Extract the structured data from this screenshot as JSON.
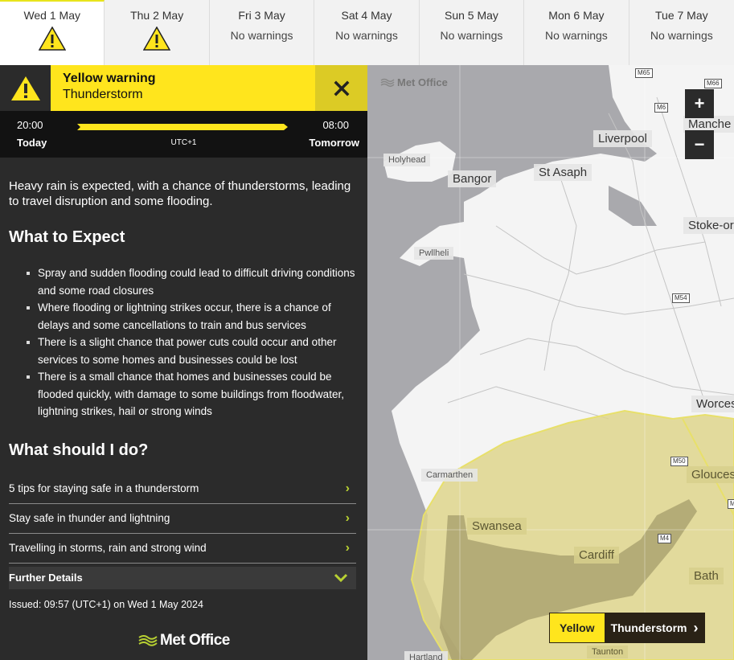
{
  "tabs": [
    {
      "day": "Wed 1 May",
      "status": "warning-icon",
      "active": true
    },
    {
      "day": "Thu 2 May",
      "status": "warning-icon",
      "active": false
    },
    {
      "day": "Fri 3 May",
      "sub": "No warnings"
    },
    {
      "day": "Sat 4 May",
      "sub": "No warnings"
    },
    {
      "day": "Sun 5 May",
      "sub": "No warnings"
    },
    {
      "day": "Mon 6 May",
      "sub": "No warnings"
    },
    {
      "day": "Tue 7 May",
      "sub": "No warnings"
    }
  ],
  "warning": {
    "level": "Yellow warning",
    "type": "Thunderstorm",
    "color": "#ffe51d",
    "start_time": "20:00",
    "start_day": "Today",
    "end_time": "08:00",
    "end_day": "Tomorrow",
    "timezone": "UTC+1",
    "lead": "Heavy rain is expected, with a chance of thunderstorms, leading to travel disruption and some flooding.",
    "expect_heading": "What to Expect",
    "expect_items": [
      "Spray and sudden flooding could lead to difficult driving conditions and some road closures",
      "Where flooding or lightning strikes occur, there is a chance of delays and some cancellations to train and bus services",
      "There is a slight chance that power cuts could occur and other services to some homes and businesses could be lost",
      "There is a small chance that homes and businesses could be flooded quickly, with damage to some buildings from floodwater, lightning strikes, hail or strong winds"
    ],
    "do_heading": "What should I do?",
    "links": [
      "5 tips for staying safe in a thunderstorm",
      "Stay safe in thunder and lightning",
      "Travelling in storms, rain and strong wind"
    ],
    "further_details": "Further Details",
    "issued": "Issued: 09:57 (UTC+1) on Wed 1 May 2024"
  },
  "footer": {
    "brand": "Met Office"
  },
  "map": {
    "watermark": "Met Office",
    "zoom_in": "+",
    "zoom_out": "−",
    "places": {
      "holyhead": "Holyhead",
      "bangor": "Bangor",
      "st_asaph": "St Asaph",
      "liverpool": "Liverpool",
      "manchester": "Manche",
      "stoke": "Stoke-or",
      "pwllheli": "Pwllheli",
      "worcester": "Worces",
      "gloucester": "Glouces",
      "carmarthen": "Carmarthen",
      "swansea": "Swansea",
      "cardiff": "Cardiff",
      "bath": "Bath",
      "taunton": "Taunton",
      "hartland": "Hartland"
    },
    "motorways": {
      "m65": "M65",
      "m66": "M66",
      "m6": "M6",
      "m54": "M54",
      "m50": "M50",
      "m4": "M4",
      "m5": "M"
    },
    "legend": {
      "level": "Yellow",
      "type": "Thunderstorm"
    }
  }
}
